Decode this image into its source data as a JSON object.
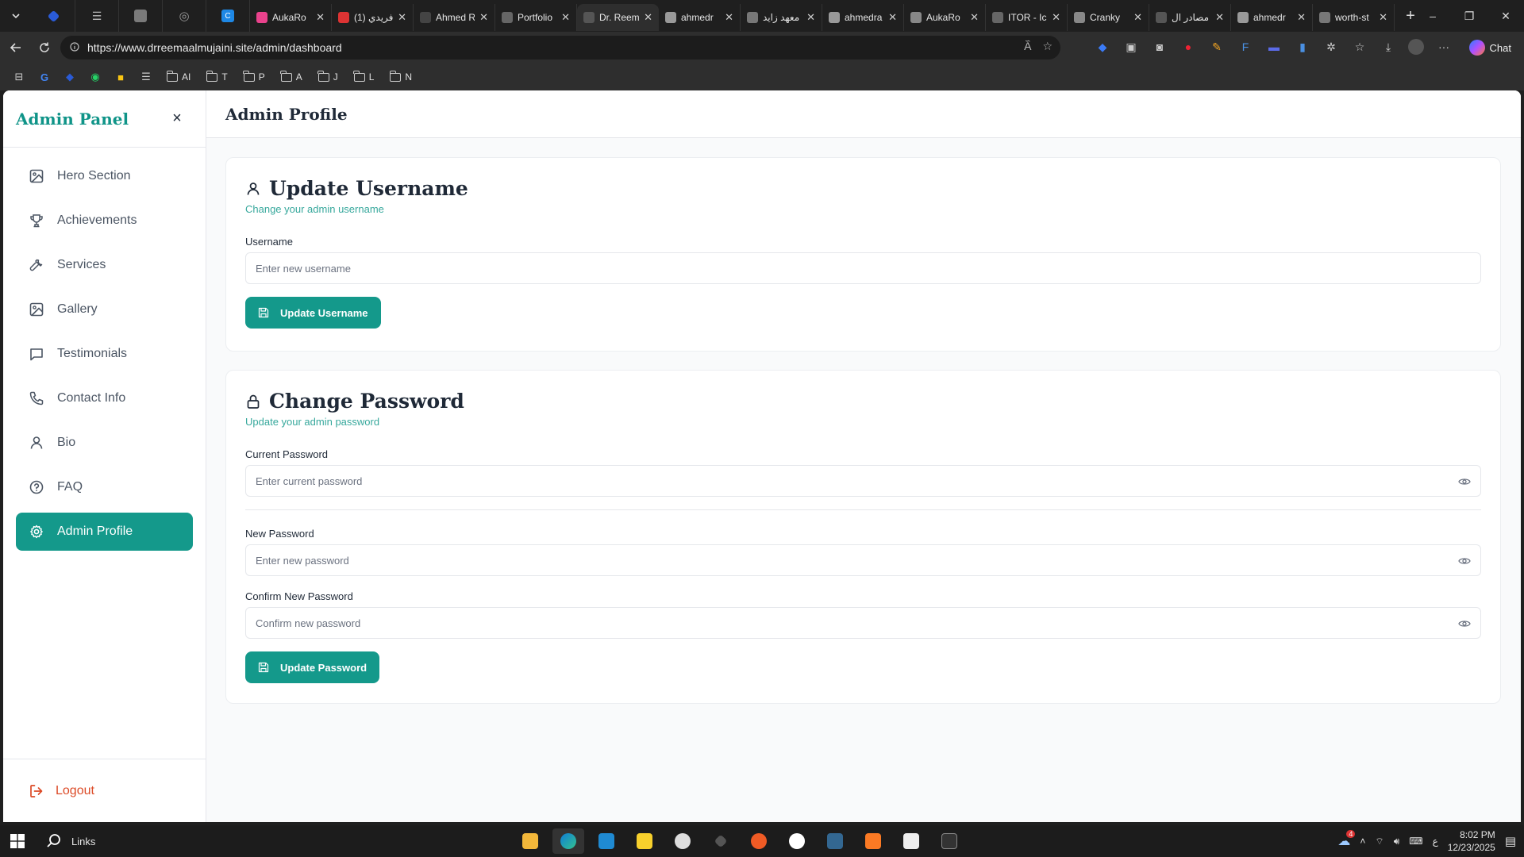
{
  "browser": {
    "tabs": [
      {
        "title": "AukaRo",
        "fav": "#e9428c",
        "close": "✕"
      },
      {
        "title": "(1) فريدي",
        "fav": "#d33",
        "close": "✕"
      },
      {
        "title": "Ahmed R",
        "fav": "#444",
        "close": "✕"
      },
      {
        "title": "Portfolio",
        "fav": "#666",
        "close": "✕"
      },
      {
        "title": "Dr. Reem",
        "fav": "#555",
        "close": "✕",
        "active": true
      },
      {
        "title": "ahmedr",
        "fav": "#999",
        "close": "✕"
      },
      {
        "title": "معهد زايد",
        "fav": "#777",
        "close": "✕"
      },
      {
        "title": "ahmedra",
        "fav": "#999",
        "close": "✕"
      },
      {
        "title": "AukaRo",
        "fav": "#888",
        "close": "✕"
      },
      {
        "title": "ITOR - Ic",
        "fav": "#666",
        "close": "✕"
      },
      {
        "title": "Cranky",
        "fav": "#888",
        "close": "✕"
      },
      {
        "title": "مصادر ال",
        "fav": "#555",
        "close": "✕"
      },
      {
        "title": "ahmedr",
        "fav": "#999",
        "close": "✕"
      },
      {
        "title": "worth-st",
        "fav": "#777",
        "close": "✕"
      }
    ],
    "pinned_tab_label": "C",
    "url": "https://www.drreemaalmujaini.site/admin/dashboard",
    "chat_label": "Chat",
    "bookmarks": [
      "AI",
      "T",
      "P",
      "A",
      "J",
      "L",
      "N"
    ]
  },
  "sidebar": {
    "title": "Admin Panel",
    "close_symbol": "×",
    "items": [
      {
        "label": "Hero Section"
      },
      {
        "label": "Achievements"
      },
      {
        "label": "Services"
      },
      {
        "label": "Gallery"
      },
      {
        "label": "Testimonials"
      },
      {
        "label": "Contact Info"
      },
      {
        "label": "Bio"
      },
      {
        "label": "FAQ"
      },
      {
        "label": "Admin Profile"
      }
    ],
    "logout_label": "Logout"
  },
  "main": {
    "title": "Admin Profile",
    "username_card": {
      "title": "Update Username",
      "subtitle": "Change your admin username",
      "field_label": "Username",
      "placeholder": "Enter new username",
      "value": "",
      "button": "Update Username"
    },
    "password_card": {
      "title": "Change Password",
      "subtitle": "Update your admin password",
      "current_label": "Current Password",
      "current_placeholder": "Enter current password",
      "new_label": "New Password",
      "new_placeholder": "Enter new password",
      "confirm_label": "Confirm New Password",
      "confirm_placeholder": "Confirm new password",
      "button": "Update Password"
    }
  },
  "colors": {
    "brand": "#14998b",
    "logout": "#dc4a26"
  },
  "taskbar": {
    "search_label": "Links",
    "time": "8:02 PM",
    "date": "12/23/2025",
    "lang": "ع",
    "notif_count": "4"
  }
}
